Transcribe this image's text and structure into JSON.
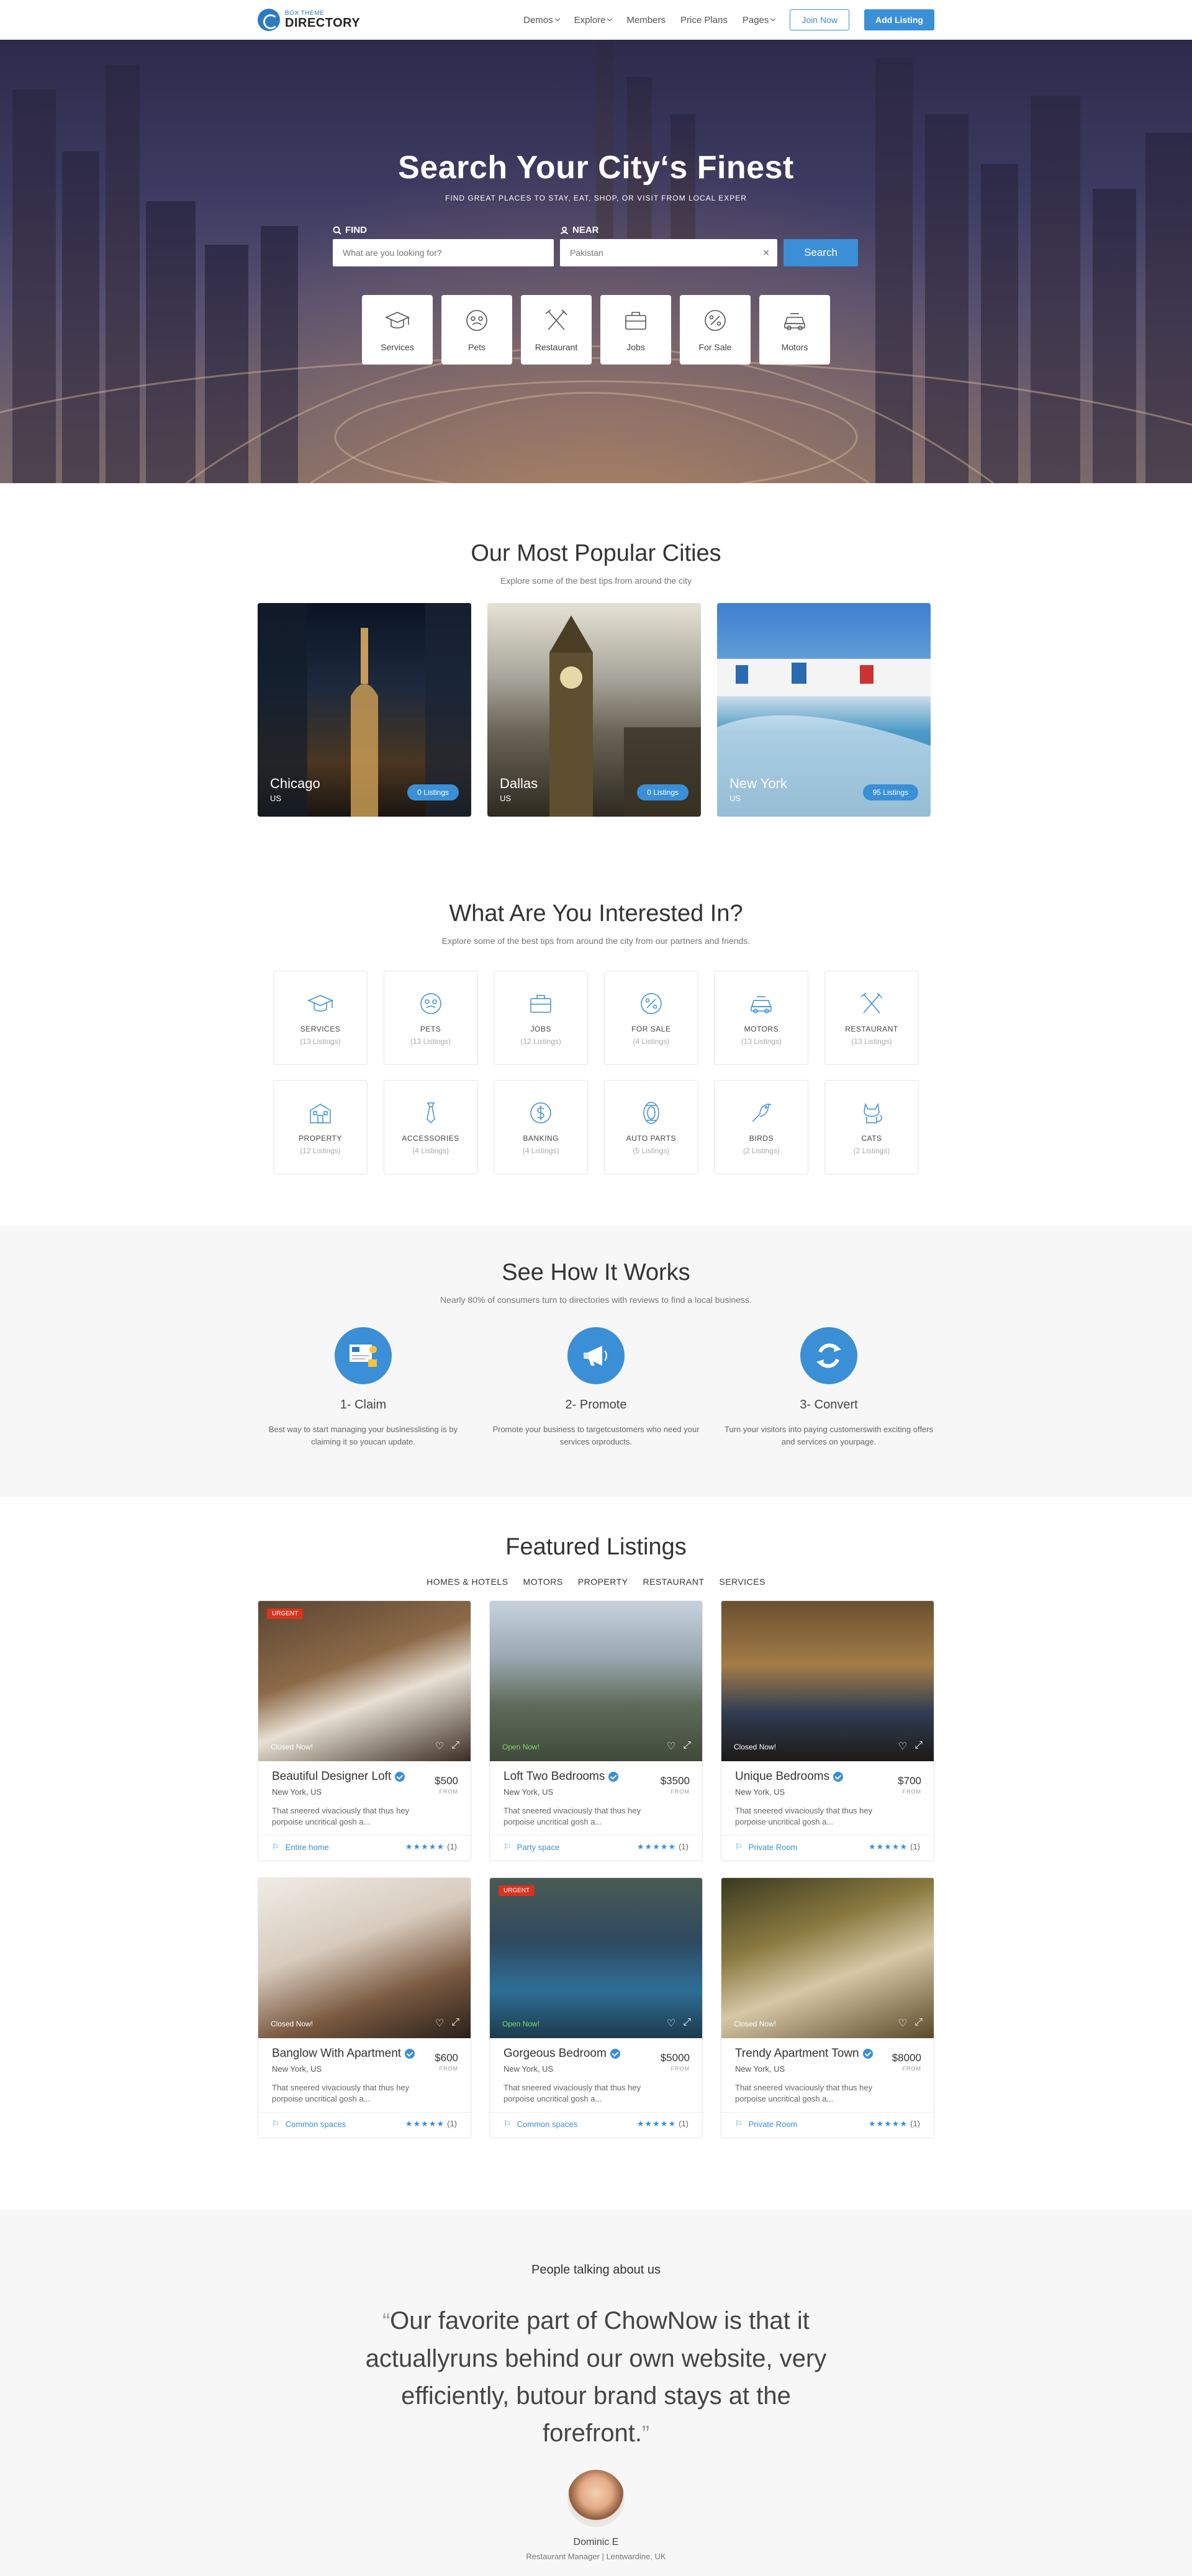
{
  "header": {
    "logo_small": "BOX THEME",
    "logo_big": "DIRECTORY",
    "nav": [
      {
        "label": "Demos",
        "dropdown": true
      },
      {
        "label": "Explore",
        "dropdown": true
      },
      {
        "label": "Members",
        "dropdown": false
      },
      {
        "label": "Price Plans",
        "dropdown": false
      },
      {
        "label": "Pages",
        "dropdown": true
      }
    ],
    "join_label": "Join Now",
    "add_label": "Add Listing"
  },
  "hero": {
    "title": "Search Your City‘s Finest",
    "subtitle": "FIND GREAT PLACES TO STAY, EAT, SHOP, OR VISIT FROM LOCAL EXPER",
    "find_label": "FIND",
    "near_label": "NEAR",
    "find_placeholder": "What are you looking for?",
    "near_placeholder": "Pakistan",
    "search_button": "Search",
    "categories": [
      {
        "label": "Services",
        "icon": "graduation-cap-icon"
      },
      {
        "label": "Pets",
        "icon": "pets-icon"
      },
      {
        "label": "Restaurant",
        "icon": "fork-knife-icon"
      },
      {
        "label": "Jobs",
        "icon": "briefcase-icon"
      },
      {
        "label": "For Sale",
        "icon": "percent-tag-icon"
      },
      {
        "label": "Motors",
        "icon": "car-icon"
      }
    ]
  },
  "cities": {
    "title": "Our Most Popular Cities",
    "subtitle": "Explore some of the best tips from around the city",
    "items": [
      {
        "name": "Chicago",
        "country": "US",
        "badge": "0 Listings"
      },
      {
        "name": "Dallas",
        "country": "US",
        "badge": "0 Listings"
      },
      {
        "name": "New York",
        "country": "US",
        "badge": "95 Listings"
      }
    ]
  },
  "interests": {
    "title": "What Are You Interested In?",
    "subtitle": "Explore some of the best tips from around the city from our partners and friends.",
    "items": [
      {
        "name": "SERVICES",
        "count": "(13 Listings)",
        "icon": "graduation-cap-icon"
      },
      {
        "name": "PETS",
        "count": "(13 Listings)",
        "icon": "pets-icon"
      },
      {
        "name": "JOBS",
        "count": "(12 Listings)",
        "icon": "briefcase-icon"
      },
      {
        "name": "FOR SALE",
        "count": "(4 Listings)",
        "icon": "percent-tag-icon"
      },
      {
        "name": "MOTORS",
        "count": "(13 Listings)",
        "icon": "car-icon"
      },
      {
        "name": "RESTAURANT",
        "count": "(13 Listings)",
        "icon": "fork-knife-icon"
      },
      {
        "name": "PROPERTY",
        "count": "(12 Listings)",
        "icon": "building-icon"
      },
      {
        "name": "ACCESSORIES",
        "count": "(4 Listings)",
        "icon": "tie-icon"
      },
      {
        "name": "BANKING",
        "count": "(4 Listings)",
        "icon": "dollar-coin-icon"
      },
      {
        "name": "AUTO PARTS",
        "count": "(5 Listings)",
        "icon": "tire-icon"
      },
      {
        "name": "BIRDS",
        "count": "(2 Listings)",
        "icon": "bird-icon"
      },
      {
        "name": "CATS",
        "count": "(2 Listings)",
        "icon": "cat-icon"
      }
    ]
  },
  "how": {
    "title": "See How It Works",
    "subtitle": "Nearly 80% of consumers turn to directories with reviews to find a local business.",
    "steps": [
      {
        "step": "1- Claim",
        "desc": "Best way to start managing your businesslisting is by claiming it so youcan update.",
        "icon": "claim-board-icon"
      },
      {
        "step": "2- Promote",
        "desc": "Promote your business to targetcustomers who need your services orproducts.",
        "icon": "megaphone-icon"
      },
      {
        "step": "3- Convert",
        "desc": "Turn your visitors into paying customerswith exciting offers and services on yourpage.",
        "icon": "convert-arrows-icon"
      }
    ]
  },
  "featured": {
    "title": "Featured Listings",
    "tabs": [
      "HOMES & HOTELS",
      "MOTORS",
      "PROPERTY",
      "RESTAURANT",
      "SERVICES"
    ],
    "listings": [
      {
        "title": "Beautiful Designer Loft",
        "price": "$500",
        "from": "FROM",
        "location": "New York, US",
        "desc": "That sneered vivaciously that thus hey porpoise uncritical gosh a...",
        "status": "Closed Now!",
        "open": false,
        "urgent": "URGENT",
        "category": "Entire home",
        "stars": "★★★★★",
        "reviews": "(1)"
      },
      {
        "title": "Loft Two Bedrooms",
        "price": "$3500",
        "from": "FROM",
        "location": "New York, US",
        "desc": "That sneered vivaciously that thus hey porpoise uncritical gosh a...",
        "status": "Open Now!",
        "open": true,
        "urgent": "",
        "category": "Party space",
        "stars": "★★★★★",
        "reviews": "(1)"
      },
      {
        "title": "Unique Bedrooms",
        "price": "$700",
        "from": "FROM",
        "location": "New York, US",
        "desc": "That sneered vivaciously that thus hey porpoise uncritical gosh a...",
        "status": "Closed Now!",
        "open": false,
        "urgent": "",
        "category": "Private Room",
        "stars": "★★★★★",
        "reviews": "(1)"
      },
      {
        "title": "Banglow With Apartment",
        "price": "$600",
        "from": "FROM",
        "location": "New York, US",
        "desc": "That sneered vivaciously that thus hey porpoise uncritical gosh a...",
        "status": "Closed Now!",
        "open": false,
        "urgent": "",
        "category": "Common spaces",
        "stars": "★★★★★",
        "reviews": "(1)"
      },
      {
        "title": "Gorgeous Bedroom",
        "price": "$5000",
        "from": "FROM",
        "location": "New York, US",
        "desc": "That sneered vivaciously that thus hey porpoise uncritical gosh a...",
        "status": "Open Now!",
        "open": true,
        "urgent": "URGENT",
        "category": "Common spaces",
        "stars": "★★★★★",
        "reviews": "(1)"
      },
      {
        "title": "Trendy Apartment Town",
        "price": "$8000",
        "from": "FROM",
        "location": "New York, US",
        "desc": "That sneered vivaciously that thus hey porpoise uncritical gosh a...",
        "status": "Closed Now!",
        "open": false,
        "urgent": "",
        "category": "Private Room",
        "stars": "★★★★★",
        "reviews": "(1)"
      }
    ]
  },
  "testimonial": {
    "heading": "People talking about us",
    "quote": "Our favorite part of ChowNow is that it actuallyruns behind our own website, very efficiently, butour brand stays at the forefront.",
    "open_mark": "“",
    "close_mark": "”",
    "name": "Dominic E",
    "role": "Restaurant Manager | Lentwardine, UK"
  },
  "colors": {
    "accent": "#3a8fd6",
    "urgent": "#d9331f",
    "open": "#7ddc6a"
  }
}
